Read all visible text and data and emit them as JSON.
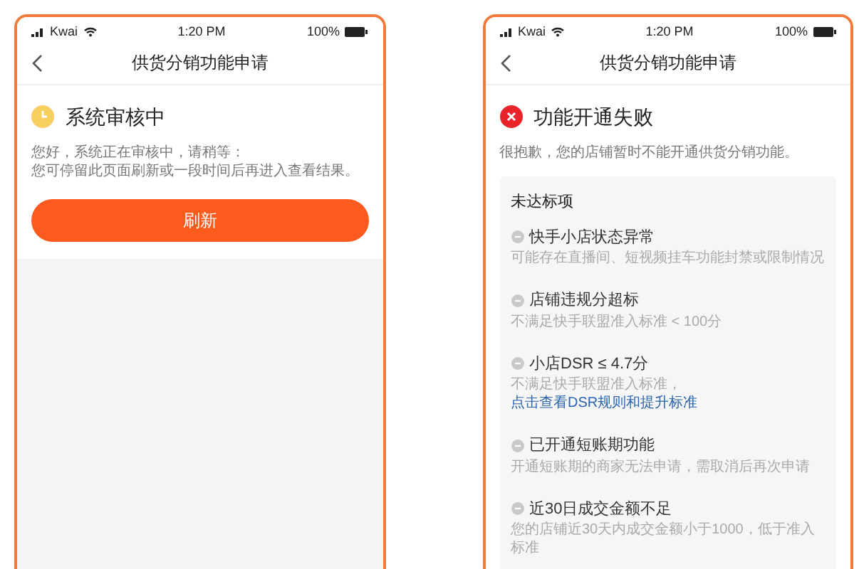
{
  "screens": [
    {
      "status_bar": {
        "carrier": "Kwai",
        "time": "1:20 PM",
        "battery": "100%"
      },
      "nav_title": "供货分销功能申请",
      "status": {
        "kind": "pending",
        "title": "系统审核中",
        "lines": [
          "您好，系统正在审核中，请稍等：",
          "您可停留此页面刷新或一段时间后再进入查看结果。"
        ]
      },
      "button": "刷新"
    },
    {
      "status_bar": {
        "carrier": "Kwai",
        "time": "1:20 PM",
        "battery": "100%"
      },
      "nav_title": "供货分销功能申请",
      "status": {
        "kind": "failed",
        "title": "功能开通失败",
        "lines": [
          "很抱歉，您的店铺暂时不能开通供货分销功能。"
        ]
      },
      "unmet": {
        "heading": "未达标项",
        "items": [
          {
            "title": "快手小店状态异常",
            "description": "可能存在直播间、短视频挂车功能封禁或限制情况"
          },
          {
            "title": "店铺违规分超标",
            "description": "不满足快手联盟准入标准 < 100分"
          },
          {
            "title": "小店DSR ≤ 4.7分",
            "description": "不满足快手联盟准入标准，",
            "link": "点击查看DSR规则和提升标准"
          },
          {
            "title": "已开通短账期功能",
            "description": "开通短账期的商家无法申请，需取消后再次申请"
          },
          {
            "title": "近30日成交金额不足",
            "description": "您的店铺近30天内成交金额小于1000，低于准入标准"
          }
        ]
      }
    }
  ]
}
